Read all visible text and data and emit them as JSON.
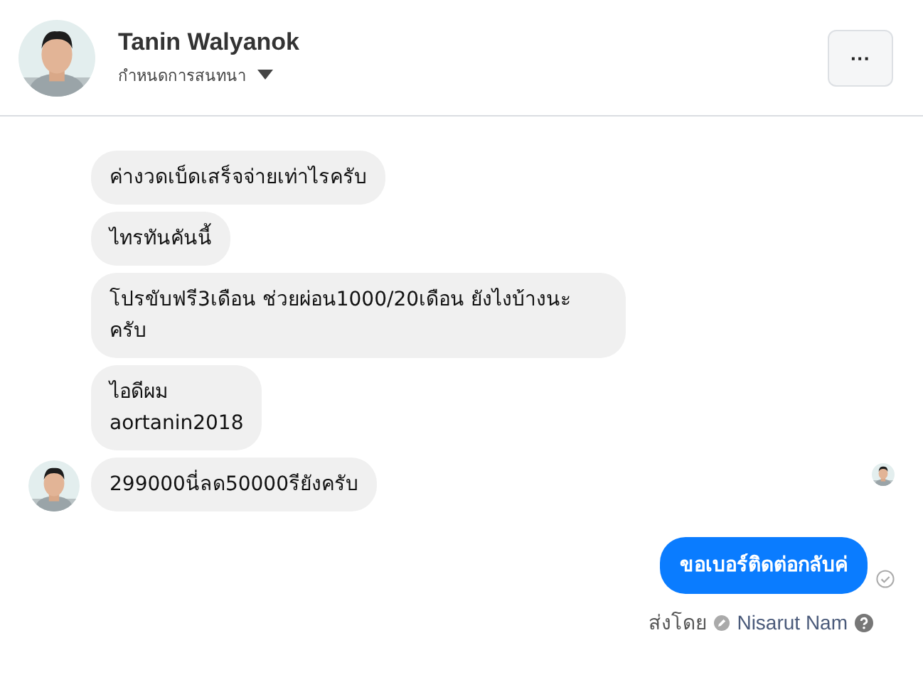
{
  "header": {
    "name": "Tanin Walyanok",
    "subtitle": "กำหนดการสนทนา",
    "more_button": "···"
  },
  "messages": [
    {
      "kind": "them",
      "text": "ค่างวดเบ็ดเสร็จจ่ายเท่าไรครับ",
      "avatar": false
    },
    {
      "kind": "them",
      "text": "ไทรทันคันนี้",
      "avatar": false
    },
    {
      "kind": "them",
      "text": "โปรขับฟรี3เดือน ช่วยผ่อน1000/20เดือน ยังไงบ้างนะครับ",
      "avatar": false
    },
    {
      "kind": "them",
      "text": "ไอดีผม\naortanin2018",
      "avatar": false
    },
    {
      "kind": "them",
      "text": "299000นี่ลด50000รียังครับ",
      "avatar": true
    },
    {
      "kind": "me",
      "text": "ขอเบอร์ติดต่อกลับค่",
      "seen": true
    }
  ],
  "sent_by": {
    "label": "ส่งโดย",
    "name": "Nisarut Nam"
  }
}
